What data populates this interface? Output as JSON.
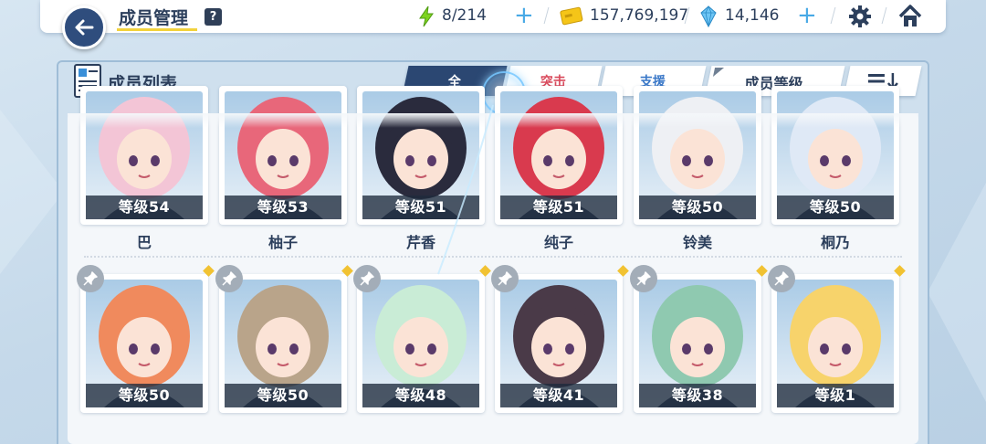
{
  "header": {
    "title": "成员管理",
    "help_label": "?"
  },
  "resources": {
    "ap": "8/214",
    "credits": "157,769,197",
    "gems": "14,146",
    "plus_glyph": "+"
  },
  "panel": {
    "title": "成员列表"
  },
  "tabs": [
    {
      "label": "全",
      "selected": true
    },
    {
      "label": "突击",
      "selected": false
    },
    {
      "label": "支援",
      "selected": false
    }
  ],
  "sort": {
    "label": "成员等级"
  },
  "members_row1": [
    {
      "level": "等级54",
      "name": "巴",
      "palette": "#f3c5d6"
    },
    {
      "level": "等级53",
      "name": "柚子",
      "palette": "#e8677a"
    },
    {
      "level": "等级51",
      "name": "芹香",
      "palette": "#2a2b3d"
    },
    {
      "level": "等级51",
      "name": "纯子",
      "palette": "#d93a4e"
    },
    {
      "level": "等级50",
      "name": "铃美",
      "palette": "#eef0f4"
    },
    {
      "level": "等级50",
      "name": "桐乃",
      "palette": "#dfe9f6"
    }
  ],
  "members_row2": [
    {
      "level": "等级50",
      "name": "",
      "palette": "#f08a5d"
    },
    {
      "level": "等级50",
      "name": "",
      "palette": "#b9a48a"
    },
    {
      "level": "等级48",
      "name": "",
      "palette": "#c9ecd6"
    },
    {
      "level": "等级41",
      "name": "",
      "palette": "#4a3a48"
    },
    {
      "level": "等级38",
      "name": "",
      "palette": "#8fc9b0"
    },
    {
      "level": "等级1",
      "name": "",
      "palette": "#f7d36b"
    }
  ],
  "colors": {
    "accent": "#2b4772",
    "striker": "#d94a5c",
    "special": "#3a78c8",
    "highlight": "#f2d23c"
  }
}
